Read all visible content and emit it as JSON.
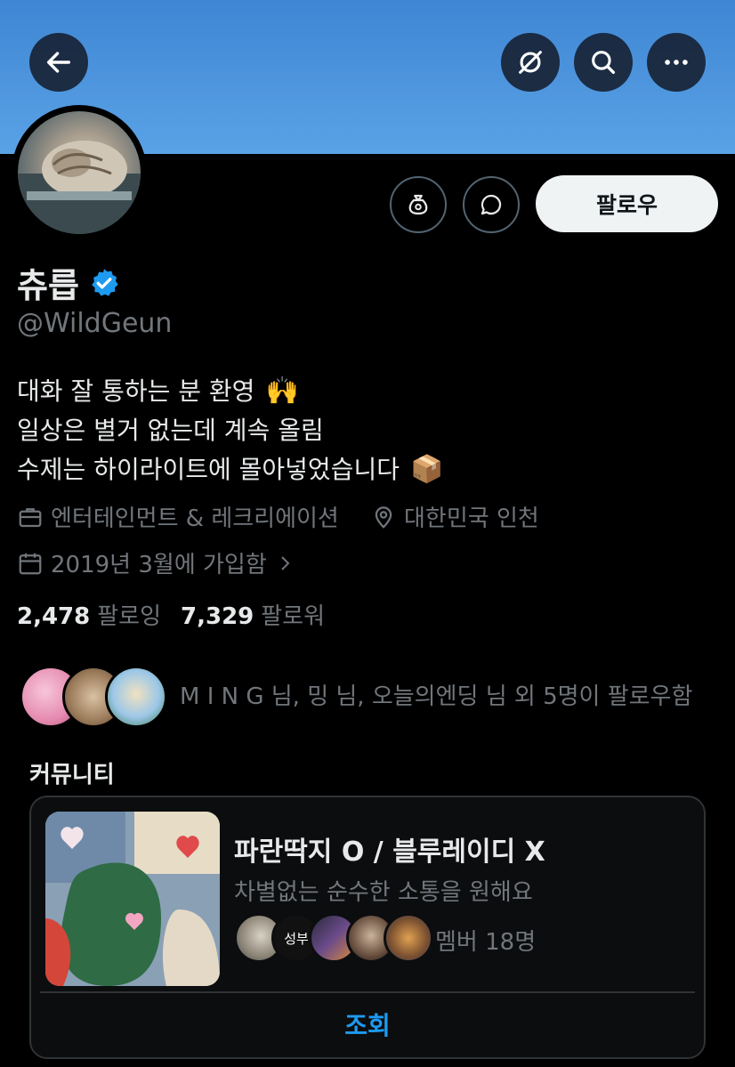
{
  "header": {
    "back_icon": "arrow-left-icon",
    "actions": [
      "grok-icon",
      "search-icon",
      "more-icon"
    ]
  },
  "profile": {
    "name": "츄릅",
    "verified": true,
    "handle": "@WildGeun",
    "follow_label": "팔로우",
    "bio": [
      {
        "text": "대화 잘 통하는 분 환영",
        "emoji": "🙌"
      },
      {
        "text": "일상은 별거 없는데 계속 올림",
        "emoji": ""
      },
      {
        "text": "수제는 하이라이트에 몰아넣었습니다",
        "emoji": "📦"
      }
    ],
    "category": "엔터테인먼트 & 레크리에이션",
    "location": "대한민국 인천",
    "joined": "2019년 3월에 가입함",
    "following_count": "2,478",
    "following_label": "팔로잉",
    "followers_count": "7,329",
    "followers_label": "팔로워",
    "followed_by": "M I N G 님, 밍 님, 오늘의엔딩 님 외 5명이 팔로우함"
  },
  "community": {
    "section_title": "커뮤니티",
    "name": "파란딱지 O / 블루레이디 X",
    "description": "차별없는 순수한 소통을 원해요",
    "members": "멤버 18명",
    "member_avatar_text": "성부",
    "view_label": "조회"
  },
  "colors": {
    "accent": "#1d9bf0",
    "banner": "#4a92dc",
    "background": "#000000",
    "secondary_text": "#71767b"
  }
}
